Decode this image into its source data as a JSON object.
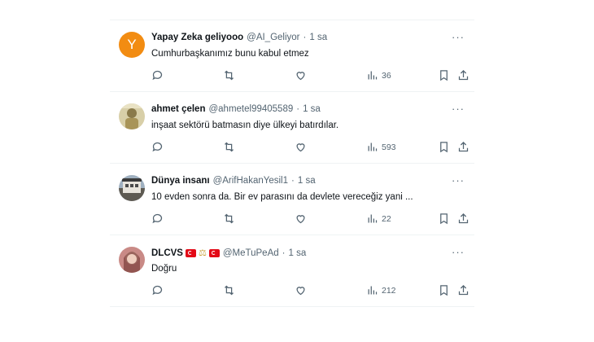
{
  "tweets": [
    {
      "name": "Yapay Zeka geliyooo",
      "handle": "@AI_Geliyor",
      "dot": "·",
      "time": "1 sa",
      "text": "Cumhurbaşkanımız bunu kabul etmez",
      "views": "36",
      "avatar_letter": "Y",
      "avatar_color": "#f28c12"
    },
    {
      "name": "ahmet çelen",
      "handle": "@ahmetel99405589",
      "dot": "·",
      "time": "1 sa",
      "text": "inşaat sektörü batmasın diye ülkeyi batırdılar.",
      "views": "593"
    },
    {
      "name": "Dünya insanı",
      "handle": "@ArifHakanYesil1",
      "dot": "·",
      "time": "1 sa",
      "text": "10 evden sonra da. Bir ev parasını da devlete vereceğiz yani ...",
      "views": "22"
    },
    {
      "name": "DLCVS",
      "handle": "@MeTuPeAd",
      "dot": "·",
      "time": "1 sa",
      "text": "Doğru",
      "views": "212"
    }
  ],
  "more_label": "···",
  "icons": {
    "reply": "reply-icon",
    "retweet": "retweet-icon",
    "like": "like-icon",
    "views": "views-icon",
    "bookmark": "bookmark-icon",
    "share": "share-icon",
    "more": "more-icon"
  },
  "colors": {
    "text": "#0f1419",
    "muted": "#536471",
    "divider": "#eff3f4"
  }
}
